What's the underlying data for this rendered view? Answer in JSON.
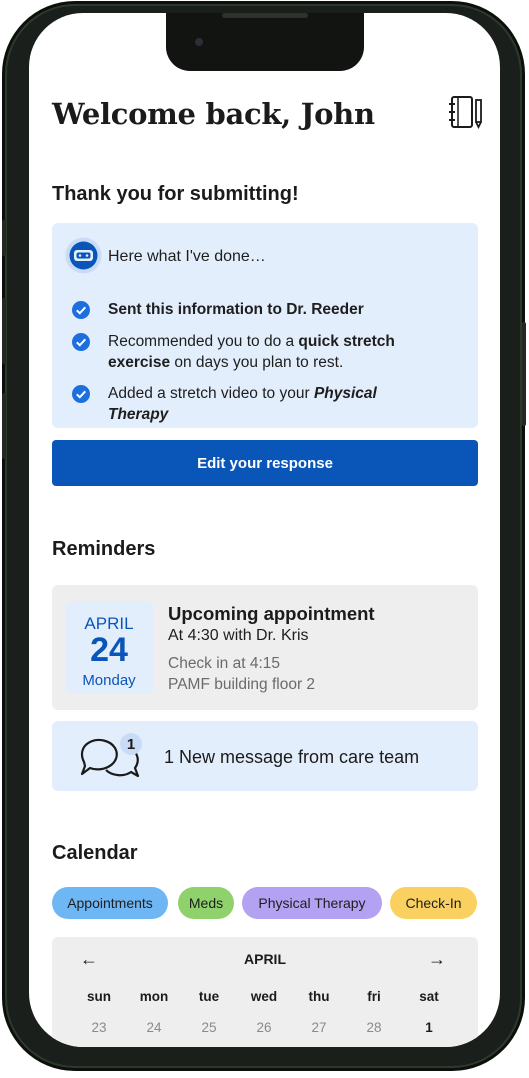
{
  "header": {
    "welcome": "Welcome back, John",
    "notebook_icon": "notebook-pencil-icon"
  },
  "submission": {
    "title": "Thank you for submitting!",
    "intro": "Here what I've done…",
    "items": [
      {
        "prefix": "",
        "bold": "Sent this information to Dr. Reeder",
        "middle": "",
        "bold_italic": ""
      },
      {
        "prefix": "Recommended you to do a ",
        "bold": "quick stretch exercise",
        "middle": " on days you plan to rest.",
        "bold_italic": ""
      },
      {
        "prefix": "Added a stretch video to your ",
        "bold": "",
        "middle": "",
        "bold_italic": "Physical Therapy"
      }
    ],
    "edit_button": "Edit your response"
  },
  "reminders": {
    "title": "Reminders",
    "appointment": {
      "month": "APRIL",
      "day": "24",
      "weekday": "Monday",
      "title": "Upcoming appointment",
      "time": "At 4:30 with Dr. Kris",
      "checkin": "Check in at 4:15",
      "location": "PAMF building floor 2"
    },
    "message": {
      "badge_count": "1",
      "text": "1 New message from care team"
    }
  },
  "calendar": {
    "title": "Calendar",
    "filters": [
      {
        "label": "Appointments",
        "color": "#6fb6f4"
      },
      {
        "label": "Meds",
        "color": "#8fd16b"
      },
      {
        "label": "Physical Therapy",
        "color": "#b3a1f1"
      },
      {
        "label": "Check-In",
        "color": "#fad160"
      }
    ],
    "prev": "←",
    "next": "→",
    "month": "APRIL",
    "days_of_week": [
      "sun",
      "mon",
      "tue",
      "wed",
      "thu",
      "fri",
      "sat"
    ],
    "dates": [
      "23",
      "24",
      "25",
      "26",
      "27",
      "28",
      "1"
    ]
  },
  "colors": {
    "primary": "#0a56b8",
    "light_blue": "#e3eefc",
    "card_gray": "#eeeeee"
  }
}
